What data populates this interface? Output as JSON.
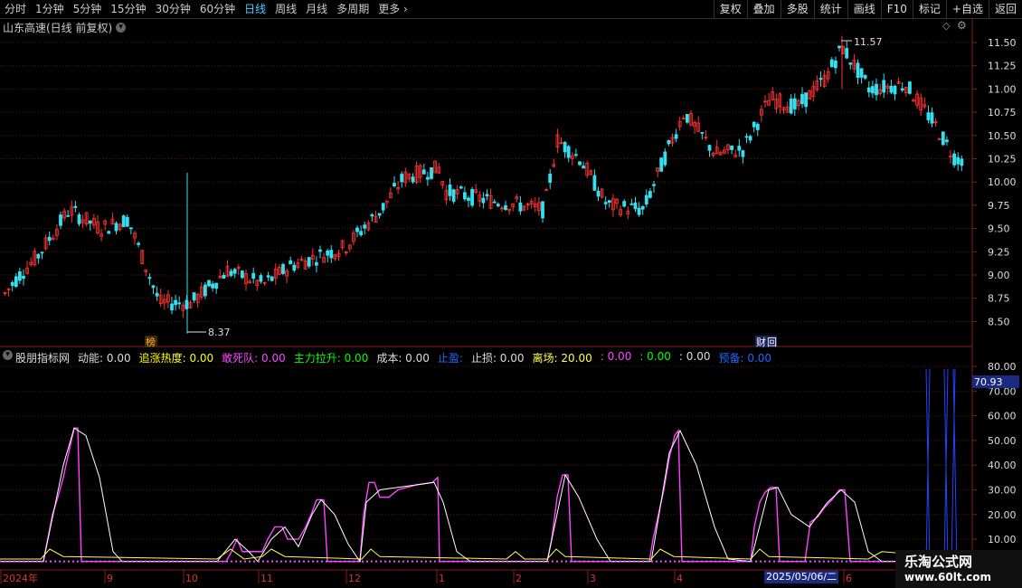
{
  "toolbar": {
    "periods": [
      "分时",
      "1分钟",
      "5分钟",
      "15分钟",
      "30分钟",
      "60分钟",
      "日线",
      "周线",
      "月线",
      "多周期",
      "更多"
    ],
    "active_period": "日线",
    "right_buttons": [
      "复权",
      "叠加",
      "多股",
      "统计",
      "画线",
      "F10",
      "标记",
      "+自选",
      "返回"
    ]
  },
  "stock": {
    "title": "山东高速(日线 前复权)",
    "high_label": "11.57",
    "low_label": "8.37",
    "bang_tag": "榜",
    "cai_tag": "财"
  },
  "price_axis": [
    "11.50",
    "11.25",
    "11.00",
    "10.75",
    "10.50",
    "10.25",
    "10.00",
    "9.75",
    "9.50",
    "9.25",
    "9.00",
    "8.75",
    "8.50"
  ],
  "indicator": {
    "name": "股朋指标网",
    "fields": [
      {
        "label": "动能: 0.00",
        "color": "#dddddd"
      },
      {
        "label": "追涨热度: 0.00",
        "color": "#ffff00"
      },
      {
        "label": "敢死队: 0.00",
        "color": "#ff44ff"
      },
      {
        "label": "主力拉升: 0.00",
        "color": "#00ff00"
      },
      {
        "label": "成本: 0.00",
        "color": "#dddddd"
      },
      {
        "label": "止盈: ",
        "color": "#2266ff"
      },
      {
        "label": "止损: 0.00",
        "color": "#dddddd"
      },
      {
        "label": "离场: 20.00",
        "color": "#ffff55"
      },
      {
        "label": ": 0.00",
        "color": "#ff44ff"
      },
      {
        "label": ": 0.00",
        "color": "#00ff00"
      },
      {
        "label": ": 0.00",
        "color": "#dddddd"
      },
      {
        "label": "预备: 0.00",
        "color": "#2266ff"
      }
    ],
    "axis": [
      "80.00",
      "70.00",
      "60.00",
      "50.00",
      "40.00",
      "30.00",
      "20.00",
      "10.00"
    ],
    "current_value": "70.93"
  },
  "date_axis": [
    "2024年",
    "9",
    "10",
    "11",
    "12",
    "1",
    "2",
    "3",
    "4",
    "2025/05/06/二",
    "6"
  ],
  "watermark": {
    "line1": "乐淘公式网",
    "line2": "www.60lt.com"
  }
}
